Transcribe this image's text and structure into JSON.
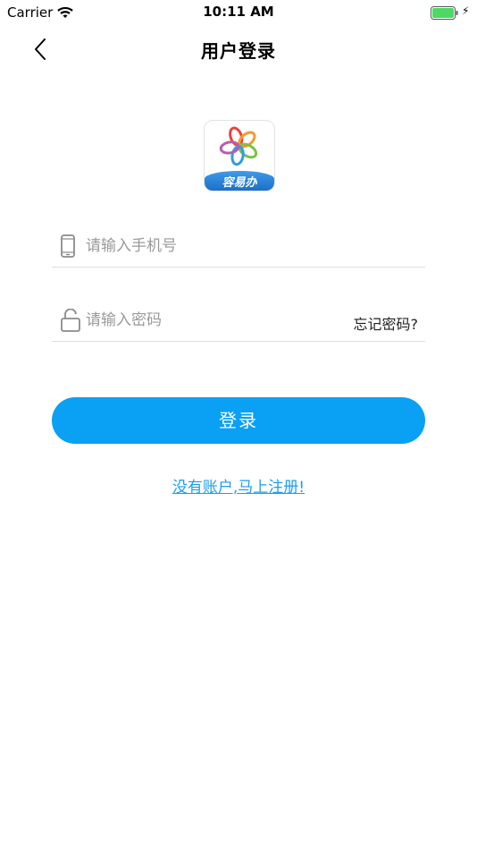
{
  "status_bar": {
    "carrier": "Carrier",
    "time": "10:11 AM"
  },
  "nav": {
    "title": "用户登录",
    "back_icon": "chevron-left-icon"
  },
  "logo": {
    "text": "容易办",
    "band_color": "#1c6fc9"
  },
  "phone_field": {
    "placeholder": "请输入手机号",
    "value": "",
    "icon": "phone-icon"
  },
  "password_field": {
    "placeholder": "请输入密码",
    "value": "",
    "icon": "lock-icon",
    "forgot_label": "忘记密码?"
  },
  "login_button": {
    "label": "登录",
    "color": "#0aa0f4"
  },
  "register_link": {
    "label": "没有账户,马上注册!",
    "color": "#1a9ef0"
  }
}
